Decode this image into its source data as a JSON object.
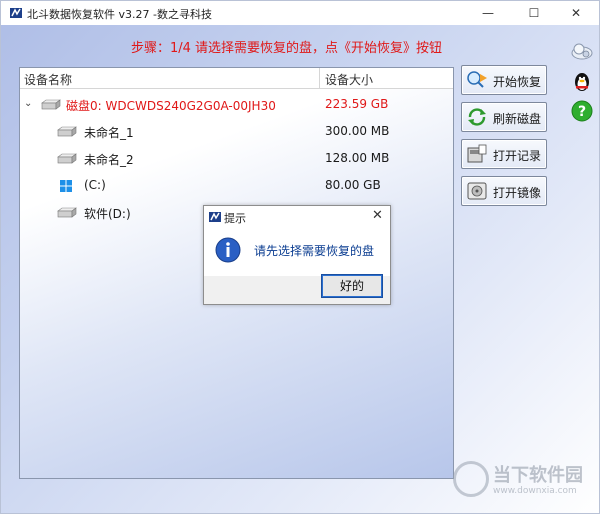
{
  "window": {
    "title": "北斗数据恢复软件 v3.27 -数之寻科技",
    "minimize": "—",
    "maximize": "☐",
    "close": "✕"
  },
  "step_text": "步骤：1/4 请选择需要恢复的盘，点《开始恢复》按钮",
  "tree": {
    "columns": {
      "name": "设备名称",
      "size": "设备大小"
    },
    "rows": [
      {
        "name": "磁盘0: WDCWDS240G2G0A-00JH30",
        "size": "223.59 GB",
        "type": "disk"
      },
      {
        "name": "未命名_1",
        "size": "300.00 MB",
        "type": "partition"
      },
      {
        "name": "未命名_2",
        "size": "128.00 MB",
        "type": "partition"
      },
      {
        "name": "(C:)",
        "size": "80.00 GB",
        "type": "windows"
      },
      {
        "name": "软件(D:)",
        "size": "",
        "type": "partition"
      }
    ]
  },
  "buttons": {
    "start": "开始恢复",
    "refresh": "刷新磁盘",
    "open_log": "打开记录",
    "open_image": "打开镜像"
  },
  "dialog": {
    "title": "提示",
    "message": "请先选择需要恢复的盘",
    "ok": "好的",
    "close": "✕"
  },
  "watermark": {
    "text": "当下软件园",
    "url": "www.downxia.com"
  },
  "colors": {
    "accent_red": "#e01818",
    "dialog_text": "#0b3d91"
  }
}
